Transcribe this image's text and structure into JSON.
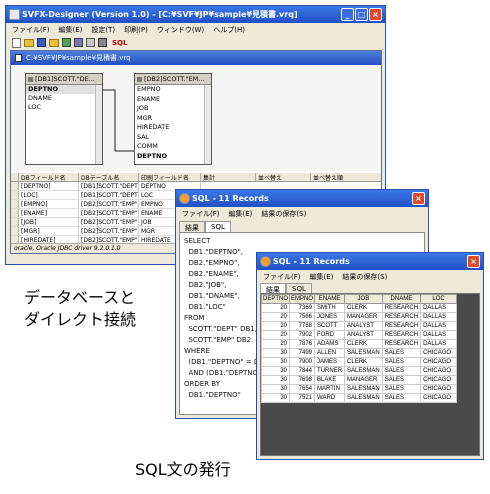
{
  "main_window": {
    "title": "SVFX-Designer (Version 1.0) - [C:¥SVF¥JP¥sample¥見積書.vrq]",
    "menu": [
      "ファイル(F)",
      "編集(E)",
      "設定(T)",
      "印刷(P)",
      "ウィンドウ(W)",
      "ヘルプ(H)"
    ],
    "toolbar_label": "SQL",
    "tab_title": "C:¥SVF¥JP¥sample¥見積書.vrq",
    "db1": {
      "title": "[DB1]SCOTT.\"DE...",
      "fields": [
        "DEPTNO",
        "DNAME",
        "LOC"
      ]
    },
    "db2": {
      "title": "[DB2]SCOTT.\"EM...",
      "fields": [
        "EMPNO",
        "ENAME",
        "JOB",
        "MGR",
        "HIREDATE",
        "SAL",
        "COMM",
        "DEPTNO"
      ]
    },
    "grid_headers": [
      "DBフィールド名",
      "DBテーブル名",
      "印刷フィールド名",
      "集計",
      "並べ替え",
      "並べ替え順"
    ],
    "grid_rows": [
      [
        "[DEPTNO]",
        "[DB1]SCOTT.\"DEPT\"",
        "DEPTNO"
      ],
      [
        "[LOC]",
        "[DB1]SCOTT.\"DEPT\"",
        "LOC"
      ],
      [
        "[EMPNO]",
        "[DB2]SCOTT.\"EMP\"",
        "EMPNO"
      ],
      [
        "[ENAME]",
        "[DB2]SCOTT.\"EMP\"",
        "ENAME"
      ],
      [
        "[JOB]",
        "[DB2]SCOTT.\"EMP\"",
        "JOB"
      ],
      [
        "[MGR]",
        "[DB2]SCOTT.\"EMP\"",
        "MGR"
      ],
      [
        "[HIREDATE]",
        "[DB2]SCOTT.\"EMP\"",
        "HIREDATE"
      ]
    ],
    "status": "oracle,  Oracle JDBC driver  9.2.0.1.0"
  },
  "sql_window": {
    "title": "SQL - 11 Records",
    "menu": [
      "ファイル(F)",
      "編集(E)",
      "結果の保存(S)"
    ],
    "tabs": [
      "結果",
      "SQL"
    ],
    "sql_lines": [
      "SELECT",
      "  DB1.\"DEPTNO\",",
      "  DB2.\"EMPNO\",",
      "  DB2.\"ENAME\",",
      "  DB2.\"JOB\",",
      "  DB1.\"DNAME\",",
      "  DB1.\"LOC\"",
      "FROM",
      "  SCOTT.\"DEPT\" DB1,",
      "  SCOTT.\"EMP\" DB2",
      "WHERE",
      "  (DB1.\"DEPTNO\" = DB2",
      "  AND (DB1.\"DEPTNO\" >",
      "ORDER BY",
      "  DB1.\"DEPTNO\""
    ]
  },
  "result_window": {
    "title": "SQL - 11 Records",
    "menu": [
      "ファイル(F)",
      "編集(E)",
      "結果の保存(S)"
    ],
    "tabs": [
      "結果",
      "SQL"
    ],
    "headers": [
      "DEPTNO",
      "EMPNO",
      "ENAME",
      "JOB",
      "DNAME",
      "LOC"
    ],
    "rows": [
      [
        "20",
        "7369",
        "SMITH",
        "CLERK",
        "RESEARCH",
        "DALLAS"
      ],
      [
        "20",
        "7566",
        "JONES",
        "MANAGER",
        "RESEARCH",
        "DALLAS"
      ],
      [
        "20",
        "7788",
        "SCOTT",
        "ANALYST",
        "RESEARCH",
        "DALLAS"
      ],
      [
        "20",
        "7902",
        "FORD",
        "ANALYST",
        "RESEARCH",
        "DALLAS"
      ],
      [
        "20",
        "7876",
        "ADAMS",
        "CLERK",
        "RESEARCH",
        "DALLAS"
      ],
      [
        "30",
        "7499",
        "ALLEN",
        "SALESMAN",
        "SALES",
        "CHICAGO"
      ],
      [
        "30",
        "7900",
        "JAMES",
        "CLERK",
        "SALES",
        "CHICAGO"
      ],
      [
        "30",
        "7844",
        "TURNER",
        "SALESMAN",
        "SALES",
        "CHICAGO"
      ],
      [
        "30",
        "7698",
        "BLAKE",
        "MANAGER",
        "SALES",
        "CHICAGO"
      ],
      [
        "30",
        "7654",
        "MARTIN",
        "SALESMAN",
        "SALES",
        "CHICAGO"
      ],
      [
        "30",
        "7521",
        "WARD",
        "SALESMAN",
        "SALES",
        "CHICAGO"
      ]
    ]
  },
  "captions": {
    "left_line1": "データベースと",
    "left_line2": "ダイレクト接続",
    "bottom": "SQL文の発行"
  },
  "colors": {
    "title_blue": "#2f5bd8",
    "close_red": "#e04a2a",
    "chrome": "#ece9d8",
    "dark_area": "#4a4a4a"
  }
}
